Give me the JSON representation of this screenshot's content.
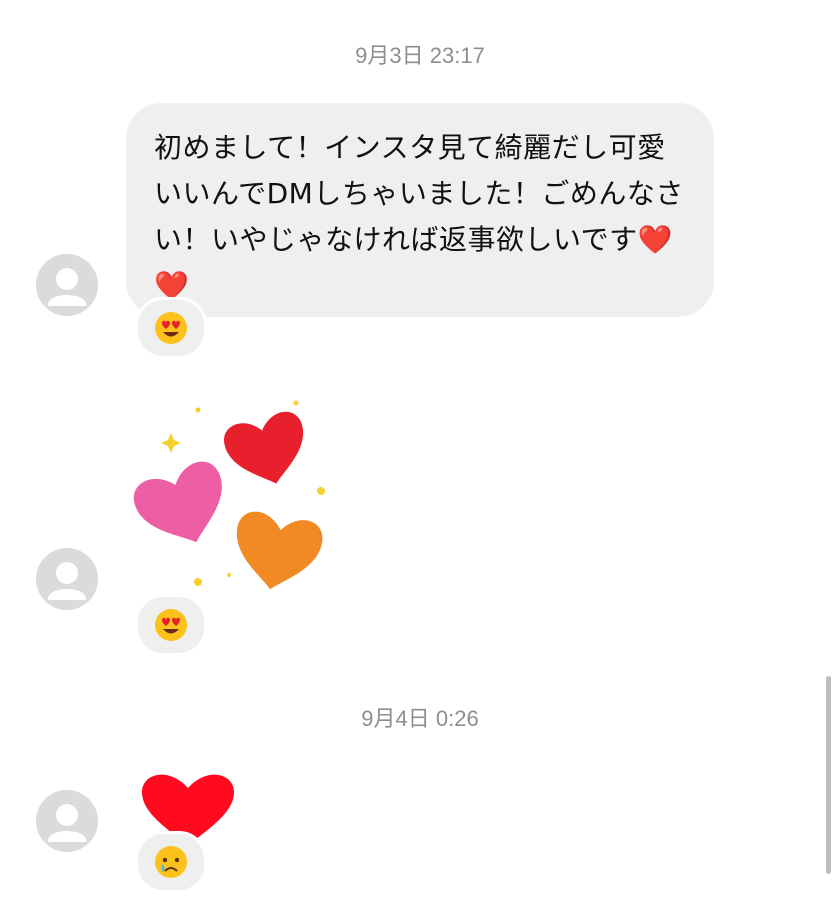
{
  "thread": {
    "timestamps": [
      "9月3日 23:17",
      "9月4日 0:26"
    ],
    "messages": [
      {
        "type": "text",
        "text": "初めまして！インスタ見て綺麗だし可愛いいんでDMしちゃいました！ごめんなさい！いやじゃなければ返事欲しいです❤️❤️",
        "reaction": "heart-eyes-emoji"
      },
      {
        "type": "sticker",
        "sticker": "three-hearts-sparkle-sticker",
        "reaction": "heart-eyes-emoji"
      },
      {
        "type": "sticker",
        "sticker": "red-heart",
        "reaction": "crying-face-emoji"
      }
    ]
  },
  "colors": {
    "bubble": "#efefef",
    "timestamp": "#8e8e8e",
    "avatar": "#dbdbdb",
    "heart_red": "#e8202e",
    "heart_pink": "#ee5ea4",
    "heart_orange": "#f28a24",
    "sparkle": "#f4d12f"
  }
}
